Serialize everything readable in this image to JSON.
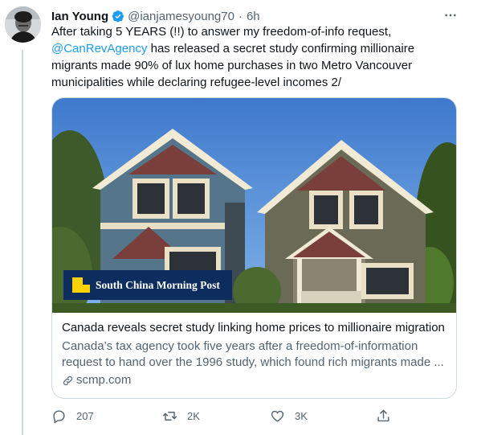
{
  "tweet": {
    "author_name": "Ian Young",
    "handle": "@ianjamesyoung70",
    "separator": "·",
    "time": "6h",
    "text_lines": [
      {
        "pre": "After taking 5 YEARS (!!) to answer my freedom-of-info request,",
        "mention": "",
        "post": ""
      },
      {
        "pre": "",
        "mention": "@CanRevAgency",
        "post": " has released a secret study confirming millionaire"
      },
      {
        "pre": "migrants made 90% of lux home purchases in two Metro Vancouver",
        "mention": "",
        "post": ""
      },
      {
        "pre": "municipalities while declaring refugee-level incomes 2/",
        "mention": "",
        "post": ""
      }
    ],
    "accent_color": "#1d9bf0"
  },
  "card": {
    "source_badge": "South China Morning Post",
    "title": "Canada reveals secret study linking home prices to millionaire migration",
    "description_lines": [
      "Canada’s tax agency took five years after a freedom-of-information",
      "request to hand over the 1996 study, which found rich migrants made ..."
    ],
    "domain": "scmp.com"
  },
  "actions": {
    "reply_count": "207",
    "retweet_count": "2K",
    "like_count": "3K"
  },
  "icons": {
    "verified": "verified-badge-icon",
    "more": "more-dots-icon",
    "link": "link-icon",
    "reply": "reply-icon",
    "retweet": "retweet-icon",
    "like": "like-icon",
    "share": "share-icon"
  }
}
